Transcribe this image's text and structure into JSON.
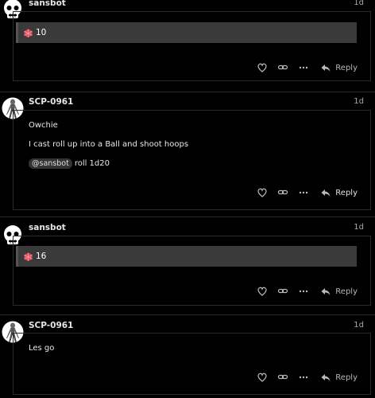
{
  "posts": [
    {
      "username": "sansbot",
      "date": "1d",
      "avatar_icon": "skull-icon",
      "roll_result": "10",
      "actions": {
        "like": "heart-icon",
        "link": "link-icon",
        "more": "ellipsis-icon",
        "reply_label": "Reply"
      }
    },
    {
      "username": "SCP-0961",
      "date": "1d",
      "avatar_icon": "creature-icon",
      "lines": [
        "Owchie",
        "I cast roll up into a Ball and shoot hoops"
      ],
      "mention": "@sansbot",
      "mention_suffix": "roll 1d20",
      "actions": {
        "like": "heart-icon",
        "link": "link-icon",
        "more": "ellipsis-icon",
        "reply_label": "Reply"
      }
    },
    {
      "username": "sansbot",
      "date": "1d",
      "avatar_icon": "skull-icon",
      "roll_result": "16",
      "actions": {
        "like": "heart-icon",
        "link": "link-icon",
        "more": "ellipsis-icon",
        "reply_label": "Reply"
      }
    },
    {
      "username": "SCP-0961",
      "date": "1d",
      "avatar_icon": "creature-icon",
      "lines": [
        "Les go"
      ],
      "actions": {
        "like": "heart-icon",
        "link": "link-icon",
        "more": "ellipsis-icon",
        "reply_label": "Reply"
      }
    }
  ],
  "colors": {
    "background": "#000000",
    "quote_bg": "#3a3a3a",
    "die": "#e0505a"
  }
}
